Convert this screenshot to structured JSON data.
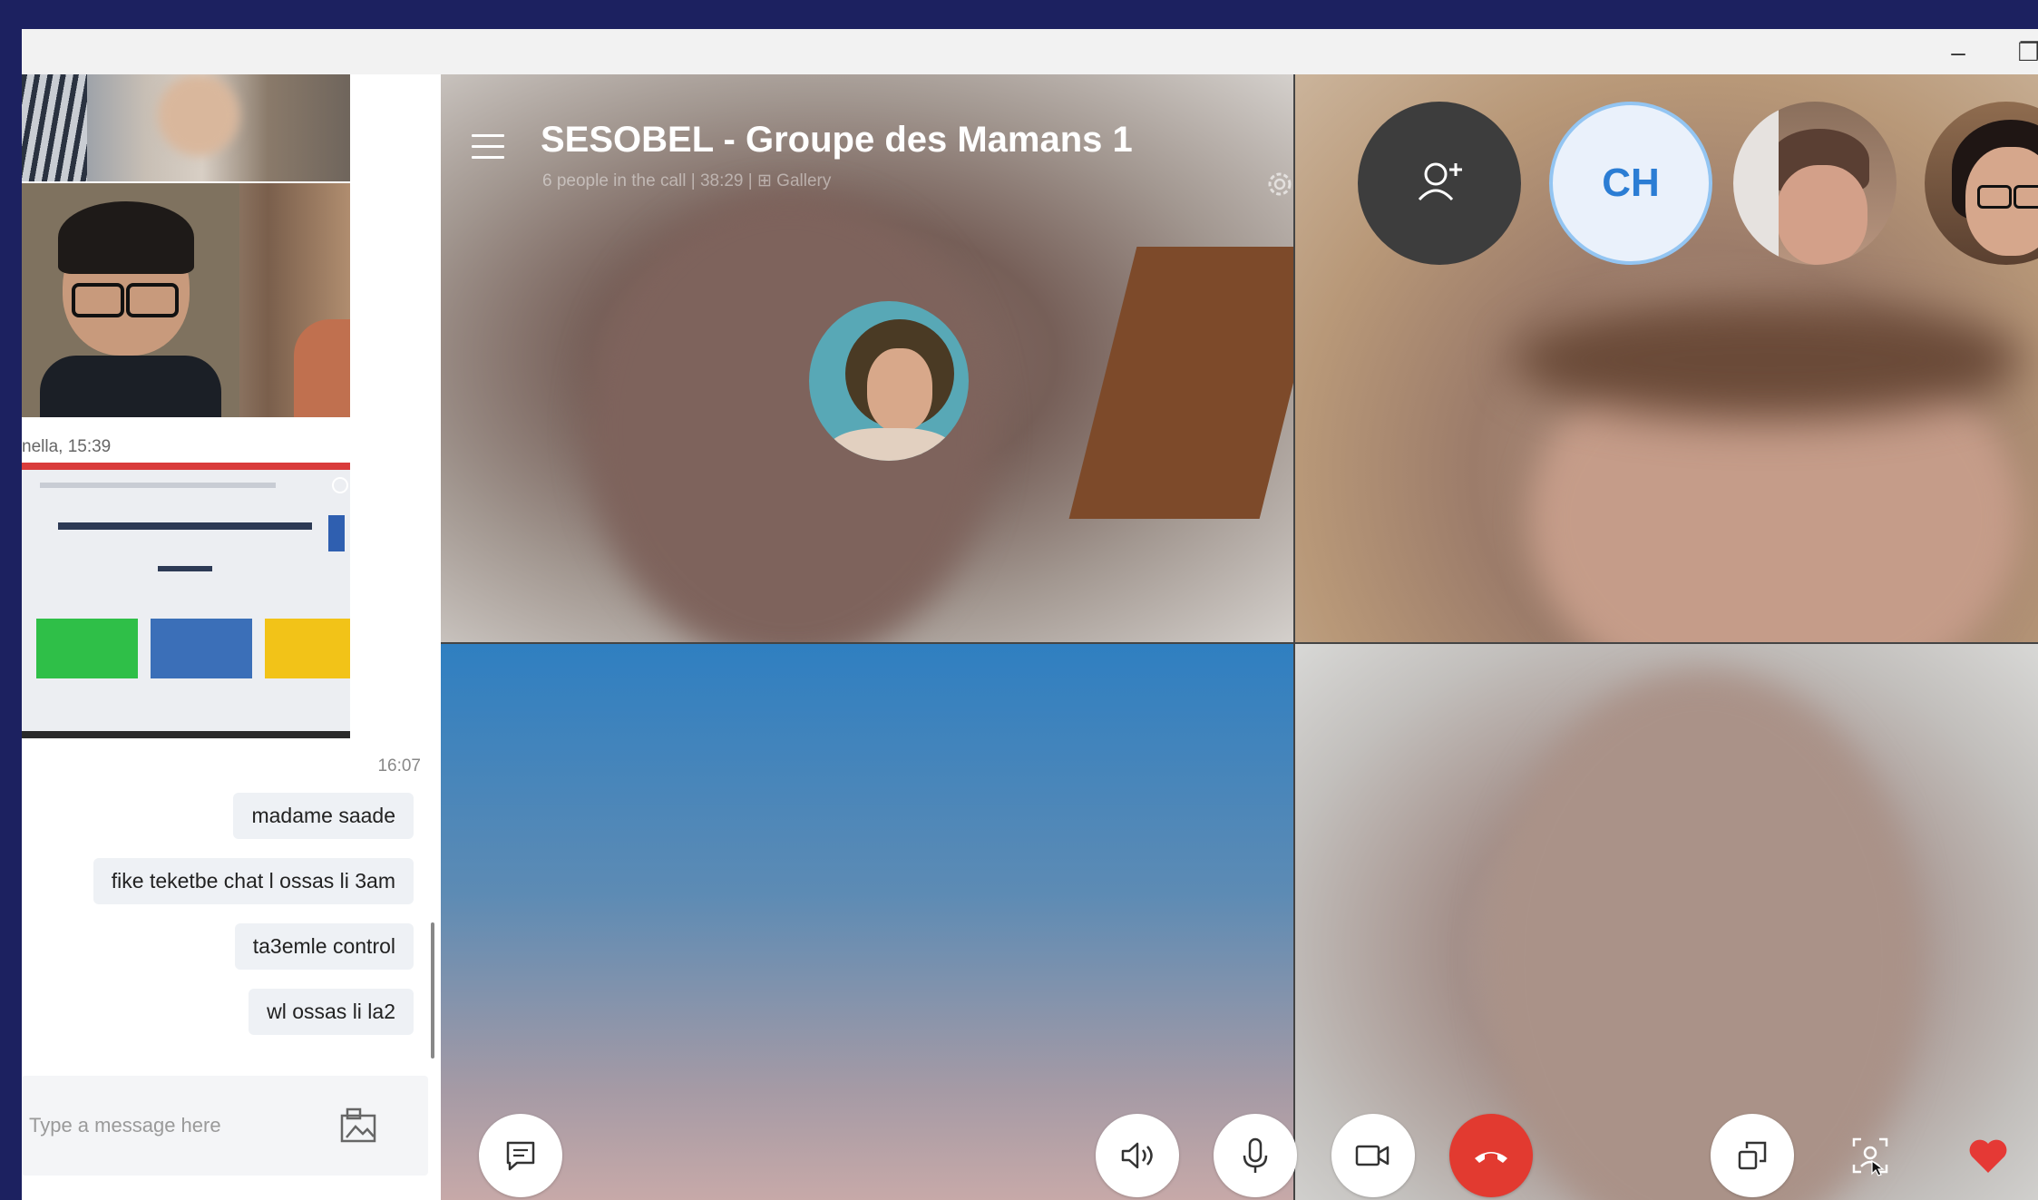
{
  "window": {
    "minimize_label": "–",
    "restore_label": "❐"
  },
  "chat": {
    "image_sender": "nella, 15:39",
    "timestamp": "16:07",
    "messages": [
      "madame saade",
      "fike teketbe chat l ossas li 3am",
      "ta3emle control",
      "wl ossas li la2"
    ],
    "composer": {
      "placeholder": "Type a message here",
      "value": ""
    }
  },
  "call": {
    "title": "SESOBEL - Groupe des Mamans 1",
    "subtitle": "6 people in the call | 38:29 | ⊞ Gallery",
    "roster_initials": "CH"
  },
  "colors": {
    "frame": "#1c2160",
    "end_call": "#e23a30",
    "initials_text": "#2b7dd4",
    "heart": "#e53935"
  }
}
